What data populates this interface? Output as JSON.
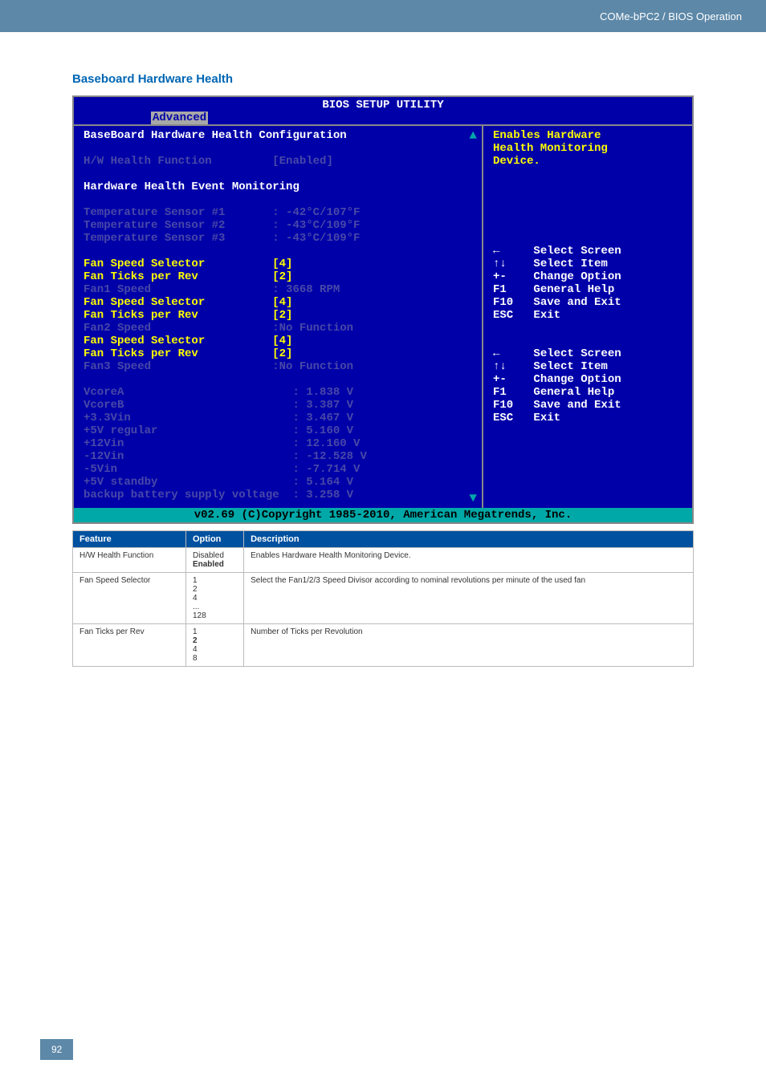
{
  "header": {
    "product": "COMe-bPC2 / BIOS Operation"
  },
  "section_title": "Baseboard Hardware Health",
  "bios": {
    "title": "BIOS SETUP UTILITY",
    "tab": "Advanced",
    "main_heading": "BaseBoard Hardware Health Configuration",
    "hw_func": {
      "label": "H/W Health Function",
      "value": "[Enabled]"
    },
    "monitoring_heading": "Hardware Health Event Monitoring",
    "temps": [
      {
        "label": "Temperature Sensor #1",
        "value": ": -42°C/107°F"
      },
      {
        "label": "Temperature Sensor #2",
        "value": ": -43°C/109°F"
      },
      {
        "label": "Temperature Sensor #3",
        "value": ": -43°C/109°F"
      }
    ],
    "fans": [
      {
        "label": "Fan Speed Selector",
        "value": "[4]",
        "yellow": true
      },
      {
        "label": "Fan Ticks per Rev",
        "value": "[2]",
        "yellow": true
      },
      {
        "label": "Fan1 Speed",
        "value": ": 3668 RPM",
        "yellow": false
      },
      {
        "label": "Fan Speed Selector",
        "value": "[4]",
        "yellow": true
      },
      {
        "label": "Fan Ticks per Rev",
        "value": "[2]",
        "yellow": true
      },
      {
        "label": "Fan2 Speed",
        "value": ":No Function",
        "yellow": false
      },
      {
        "label": "Fan Speed Selector",
        "value": "[4]",
        "yellow": true
      },
      {
        "label": "Fan Ticks per Rev",
        "value": "[2]",
        "yellow": true
      },
      {
        "label": "Fan3 Speed",
        "value": ":No Function",
        "yellow": false
      }
    ],
    "volts": [
      {
        "label": "VcoreA",
        "value": ": 1.838 V"
      },
      {
        "label": "VcoreB",
        "value": ": 3.387 V"
      },
      {
        "label": "+3.3Vin",
        "value": ": 3.467 V"
      },
      {
        "label": "+5V regular",
        "value": ": 5.160 V"
      },
      {
        "label": "+12Vin",
        "value": ": 12.160 V"
      },
      {
        "label": "-12Vin",
        "value": ": -12.528 V"
      },
      {
        "label": "-5Vin",
        "value": ": -7.714 V"
      },
      {
        "label": "+5V standby",
        "value": ": 5.164 V"
      },
      {
        "label": "backup battery supply voltage",
        "value": ": 3.258 V"
      }
    ],
    "help_text": {
      "l1": "Enables Hardware",
      "l2": "Health Monitoring",
      "l3": "Device."
    },
    "nav": [
      {
        "key": "←",
        "text": "Select Screen"
      },
      {
        "key": "↑↓",
        "text": "Select Item"
      },
      {
        "key": "+-",
        "text": "Change Option"
      },
      {
        "key": "F1",
        "text": "General Help"
      },
      {
        "key": "F10",
        "text": "Save and Exit"
      },
      {
        "key": "ESC",
        "text": "Exit"
      }
    ],
    "copyright": "v02.69 (C)Copyright 1985-2010, American Megatrends, Inc."
  },
  "table": {
    "headers": {
      "feature": "Feature",
      "option": "Option",
      "description": "Description"
    },
    "rows": [
      {
        "feature": "H/W Health Function",
        "options": [
          "Disabled",
          "Enabled"
        ],
        "bold_idx": 1,
        "desc": "Enables Hardware Health Monitoring Device."
      },
      {
        "feature": "Fan Speed Selector",
        "options": [
          "1",
          "2",
          "4",
          "...",
          "128"
        ],
        "bold_idx": -1,
        "desc": "Select the Fan1/2/3 Speed Divisor according to nominal revolutions per minute of the used fan"
      },
      {
        "feature": "Fan Ticks per Rev",
        "options": [
          "1",
          "2",
          "4",
          "8"
        ],
        "bold_idx": 1,
        "desc": "Number of Ticks per Revolution"
      }
    ]
  },
  "page_number": "92"
}
